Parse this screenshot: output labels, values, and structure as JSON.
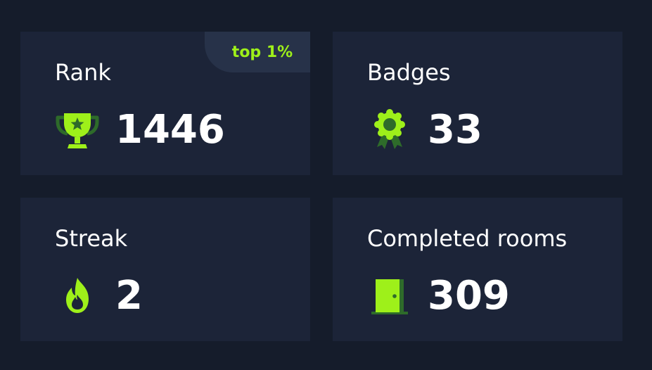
{
  "stats": {
    "rank": {
      "label": "Rank",
      "value": "1446",
      "pill": "top 1%",
      "icon": "trophy-icon"
    },
    "badges": {
      "label": "Badges",
      "value": "33",
      "icon": "award-ribbon-icon"
    },
    "streak": {
      "label": "Streak",
      "value": "2",
      "icon": "flame-icon"
    },
    "rooms": {
      "label": "Completed rooms",
      "value": "309",
      "icon": "door-icon"
    }
  },
  "colors": {
    "background": "#151c2b",
    "card": "#1c2438",
    "accent": "#9ef01a",
    "accent_dark": "#2e6b2a",
    "text": "#ffffff"
  }
}
